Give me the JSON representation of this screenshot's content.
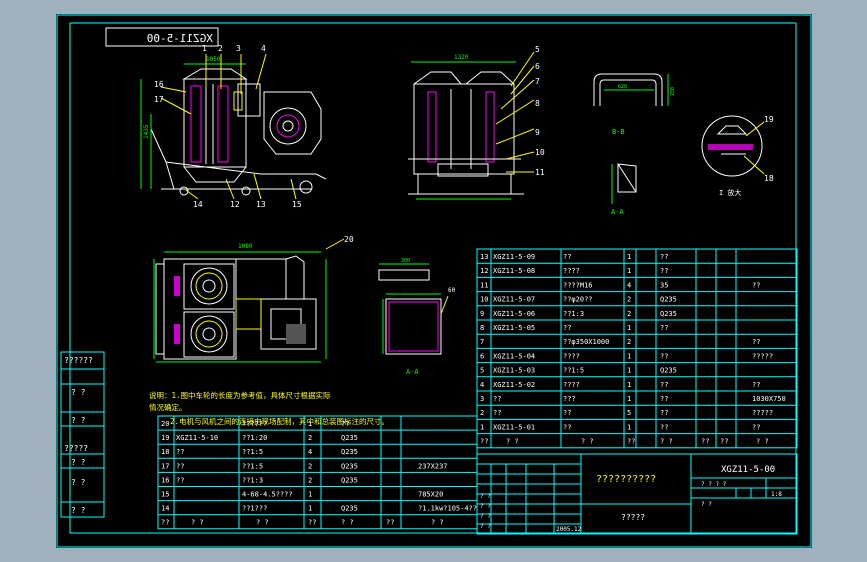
{
  "drawing_number": "XGZ11-5-00",
  "drawing_number_mirrored": "XGZ11-5-00",
  "title_block": {
    "drawing_name": "??????????",
    "company": "?????",
    "scale": "1:8",
    "date": "2005.12",
    "qmarks_sm": "? ?",
    "qmarks_lg": "? ? ? ?"
  },
  "left_stamp": [
    "??????",
    "? ?",
    "? ?",
    "?????",
    "? ?",
    "? ?",
    "? ?"
  ],
  "notes": {
    "line1": "说明：1.图中车轮的长度为参考值，具体尺寸根据实际",
    "line2": "情况确定。",
    "line3": "2.电机与风机之间的连接由现场配制，其中和总装图标注的尺寸。"
  },
  "balloons": {
    "front": [
      "1",
      "2",
      "3",
      "4",
      "16",
      "17",
      "14",
      "12",
      "13",
      "15"
    ],
    "side": [
      "5",
      "6",
      "7",
      "8",
      "9",
      "10",
      "11"
    ],
    "plan": [
      "20"
    ],
    "detail_right": [
      "19",
      "18"
    ]
  },
  "view_labels": {
    "detail_i": "I 放大",
    "section_b": "B-B",
    "view_a": "A-A",
    "small": "B-B",
    "section_a": "A-A"
  },
  "dims": {
    "front_top": "1050",
    "front_height": "1435",
    "plan_top": "1080",
    "side_width": "1320",
    "hood_w": "620",
    "hood_h": "280",
    "box_w": "300",
    "small_w": "60"
  },
  "bom_right": {
    "rows": [
      {
        "no": "13",
        "code": "XGZ11-5-09",
        "name": "??",
        "qty": "1",
        "mat": "??",
        "note": ""
      },
      {
        "no": "12",
        "code": "XGZ11-5-08",
        "name": "????",
        "qty": "1",
        "mat": "??",
        "note": ""
      },
      {
        "no": "11",
        "code": "",
        "name": "????M16",
        "qty": "4",
        "mat": "35",
        "note": "??"
      },
      {
        "no": "10",
        "code": "XGZ11-5-07",
        "name": "??φ20??",
        "qty": "2",
        "mat": "Q235",
        "note": ""
      },
      {
        "no": "9",
        "code": "XGZ11-5-06",
        "name": "??1:3",
        "qty": "2",
        "mat": "Q235",
        "note": ""
      },
      {
        "no": "8",
        "code": "XGZ11-5-05",
        "name": "??",
        "qty": "1",
        "mat": "??",
        "note": ""
      },
      {
        "no": "7",
        "code": "",
        "name": "??φ350X1000",
        "qty": "2",
        "mat": "",
        "note": "??"
      },
      {
        "no": "6",
        "code": "XGZ11-5-04",
        "name": "????",
        "qty": "1",
        "mat": "??",
        "note": "?????"
      },
      {
        "no": "5",
        "code": "XGZ11-5-03",
        "name": "??1:5",
        "qty": "1",
        "mat": "Q235",
        "note": ""
      },
      {
        "no": "4",
        "code": "XGZ11-5-02",
        "name": "????",
        "qty": "1",
        "mat": "??",
        "note": "??"
      },
      {
        "no": "3",
        "code": "??",
        "name": "???",
        "qty": "1",
        "mat": "??",
        "note": "1030X750"
      },
      {
        "no": "2",
        "code": "??",
        "name": "??",
        "qty": "5",
        "mat": "??",
        "note": "?????"
      },
      {
        "no": "1",
        "code": "XGZ11-5-01",
        "name": "??",
        "qty": "1",
        "mat": "??",
        "note": "??"
      }
    ],
    "header": {
      "no": "??",
      "code": "? ?",
      "name": "? ?",
      "qty": "??",
      "mat": "? ?",
      "w1": "??",
      "w2": "??",
      "note": "? ?"
    }
  },
  "bom_left": {
    "rows": [
      {
        "no": "20",
        "code": "",
        "name": "??????",
        "qty": "1",
        "mat": "??",
        "note": ""
      },
      {
        "no": "19",
        "code": "XGZ11-5-10",
        "name": "??1:20",
        "qty": "2",
        "mat": "Q235",
        "note": ""
      },
      {
        "no": "18",
        "code": "??",
        "name": "??1:5",
        "qty": "4",
        "mat": "Q235",
        "note": ""
      },
      {
        "no": "17",
        "code": "??",
        "name": "??1:5",
        "qty": "2",
        "mat": "Q235",
        "note": "237X237"
      },
      {
        "no": "16",
        "code": "??",
        "name": "??1:3",
        "qty": "2",
        "mat": "Q235",
        "note": ""
      },
      {
        "no": "15",
        "code": "",
        "name": "4-68-4.5????",
        "qty": "1",
        "mat": "",
        "note": "785X20"
      },
      {
        "no": "14",
        "code": "",
        "name": "??1???",
        "qty": "1",
        "mat": "Q235",
        "note": "?1.1kw?105-4??"
      }
    ],
    "header": {
      "no": "??",
      "code": "? ?",
      "name": "? ?",
      "qty": "??",
      "mat": "? ?",
      "w": "??",
      "note": "? ?"
    }
  },
  "colors": {
    "frame": "#00ffff",
    "outline": "#ffffff",
    "dimension": "#00ff00",
    "leader": "#ffff00",
    "part": "#ff00ff",
    "hatch": "#c0c0c0",
    "background": "#000000",
    "page": "#9fb1bc"
  }
}
